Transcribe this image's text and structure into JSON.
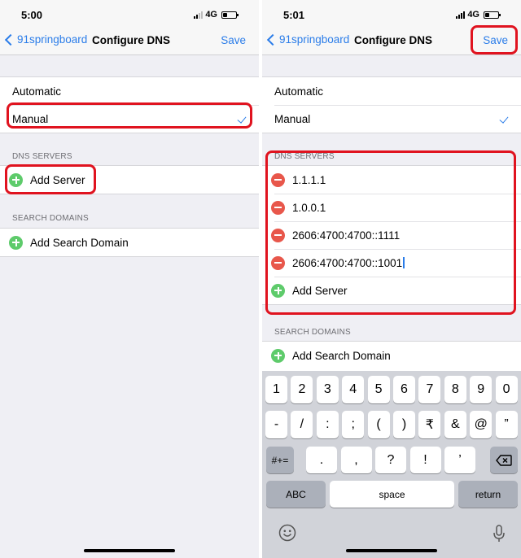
{
  "left": {
    "status": {
      "time": "5:00",
      "network": "4G"
    },
    "nav": {
      "back": "91springboard",
      "title": "Configure DNS",
      "save": "Save"
    },
    "mode_items": [
      "Automatic",
      "Manual"
    ],
    "dns_header": "DNS SERVERS",
    "add_server": "Add Server",
    "search_header": "SEARCH DOMAINS",
    "add_search_domain": "Add Search Domain"
  },
  "right": {
    "status": {
      "time": "5:01",
      "network": "4G"
    },
    "nav": {
      "back": "91springboard",
      "title": "Configure DNS",
      "save": "Save"
    },
    "mode_items": [
      "Automatic",
      "Manual"
    ],
    "dns_header": "DNS SERVERS",
    "servers": [
      "1.1.1.1",
      "1.0.0.1",
      "2606:4700:4700::1111",
      "2606:4700:4700::1001"
    ],
    "add_server": "Add Server",
    "search_header": "SEARCH DOMAINS",
    "add_search_domain": "Add Search Domain"
  },
  "keyboard": {
    "row1": [
      "1",
      "2",
      "3",
      "4",
      "5",
      "6",
      "7",
      "8",
      "9",
      "0"
    ],
    "row2": [
      "-",
      "/",
      ":",
      ";",
      "(",
      ")",
      "₹",
      "&",
      "@",
      "”"
    ],
    "row3_left": "#+=",
    "row3": [
      ".",
      ",",
      "?",
      "!",
      "’"
    ],
    "abc": "ABC",
    "space": "space",
    "return": "return"
  },
  "colors": {
    "accent": "#2b7de9",
    "highlight": "#e0131f",
    "add": "#5ecb6b",
    "remove": "#e8574b"
  }
}
